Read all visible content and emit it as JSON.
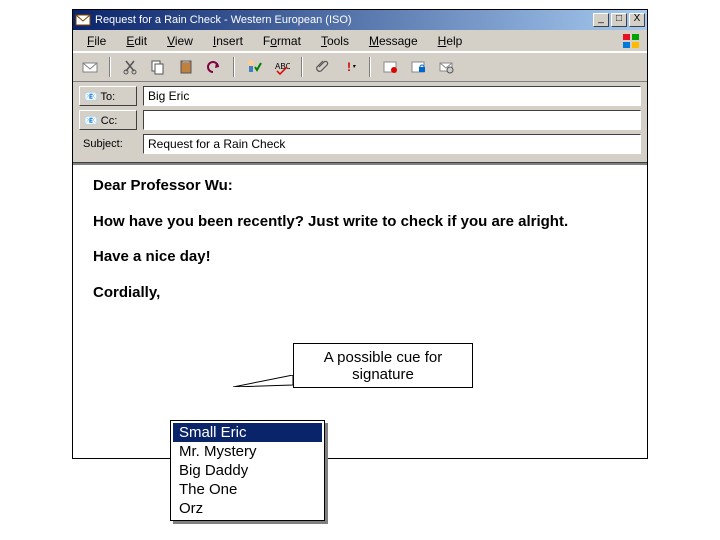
{
  "window": {
    "title": "Request for a Rain Check - Western European (ISO)",
    "min_glyph": "_",
    "max_glyph": "□",
    "close_glyph": "X"
  },
  "menu": {
    "file": "File",
    "file_u": "F",
    "edit": "Edit",
    "edit_u": "E",
    "view": "View",
    "view_u": "V",
    "insert": "Insert",
    "insert_u": "I",
    "format": "Format",
    "format_u": "o",
    "tools": "Tools",
    "tools_u": "T",
    "message": "Message",
    "message_u": "M",
    "help": "Help",
    "help_u": "H"
  },
  "fields": {
    "to_label": "📧 To:",
    "to_value": "Big Eric",
    "cc_label": "📧 Cc:",
    "cc_value": "",
    "subject_label": "Subject:",
    "subject_value": "Request for a Rain Check"
  },
  "body": {
    "greeting": "Dear Professor Wu:",
    "line1": "How have you been recently? Just write to check if you are alright.",
    "line2": "Have a nice day!",
    "closing": "Cordially,"
  },
  "callout": {
    "text": "A possible cue for signature"
  },
  "signatures": {
    "items": [
      {
        "label": "Small Eric",
        "selected": true
      },
      {
        "label": "Mr. Mystery",
        "selected": false
      },
      {
        "label": "Big Daddy",
        "selected": false
      },
      {
        "label": "The One",
        "selected": false
      },
      {
        "label": "Orz",
        "selected": false
      }
    ]
  }
}
